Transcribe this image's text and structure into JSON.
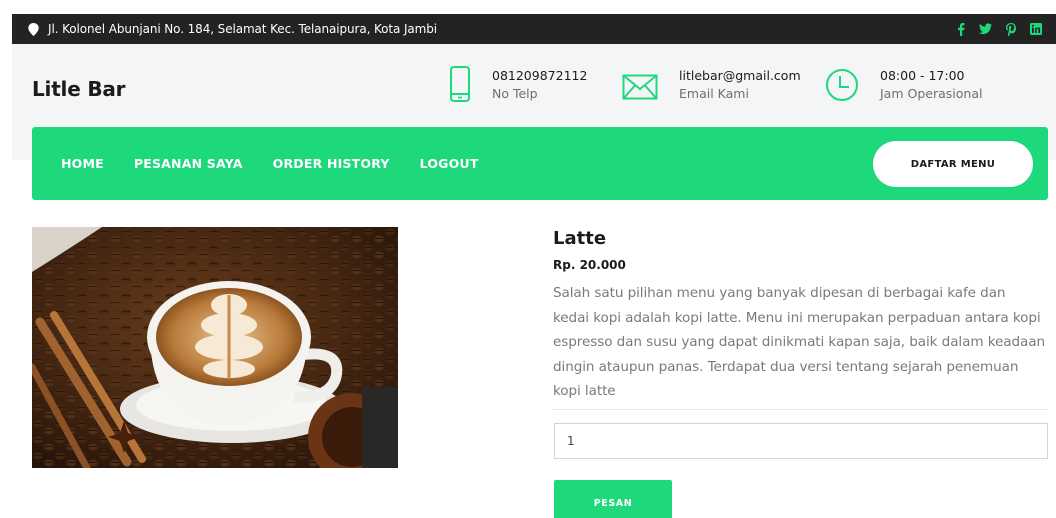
{
  "topbar": {
    "address": "Jl. Kolonel Abunjani No. 184, Selamat Kec. Telanaipura, Kota Jambi",
    "socials": [
      "facebook-icon",
      "twitter-icon",
      "pinterest-icon",
      "linkedin-icon"
    ]
  },
  "header": {
    "brand": "Litle Bar",
    "phone": {
      "value": "081209872112",
      "label": "No Telp"
    },
    "email": {
      "value": "litlebar@gmail.com",
      "label": "Email Kami"
    },
    "hours": {
      "value": "08:00 - 17:00",
      "label": "Jam Operasional"
    }
  },
  "nav": {
    "items": [
      "HOME",
      "PESANAN SAYA",
      "ORDER HISTORY",
      "LOGOUT"
    ],
    "menu_button": "DAFTAR MENU"
  },
  "product": {
    "name": "Latte",
    "price": "Rp. 20.000",
    "description": "Salah satu pilihan menu yang banyak dipesan di berbagai kafe dan kedai kopi adalah kopi latte. Menu ini merupakan perpaduan antara kopi espresso dan susu yang dapat dinikmati kapan saja, baik dalam keadaan dingin ataupun panas. Terdapat dua versi tentang sejarah penemuan kopi latte",
    "quantity": "1",
    "order_button": "PESAN"
  },
  "colors": {
    "accent": "#1ed87c",
    "topbar": "#232323",
    "header_bg": "#f4f5f7"
  }
}
